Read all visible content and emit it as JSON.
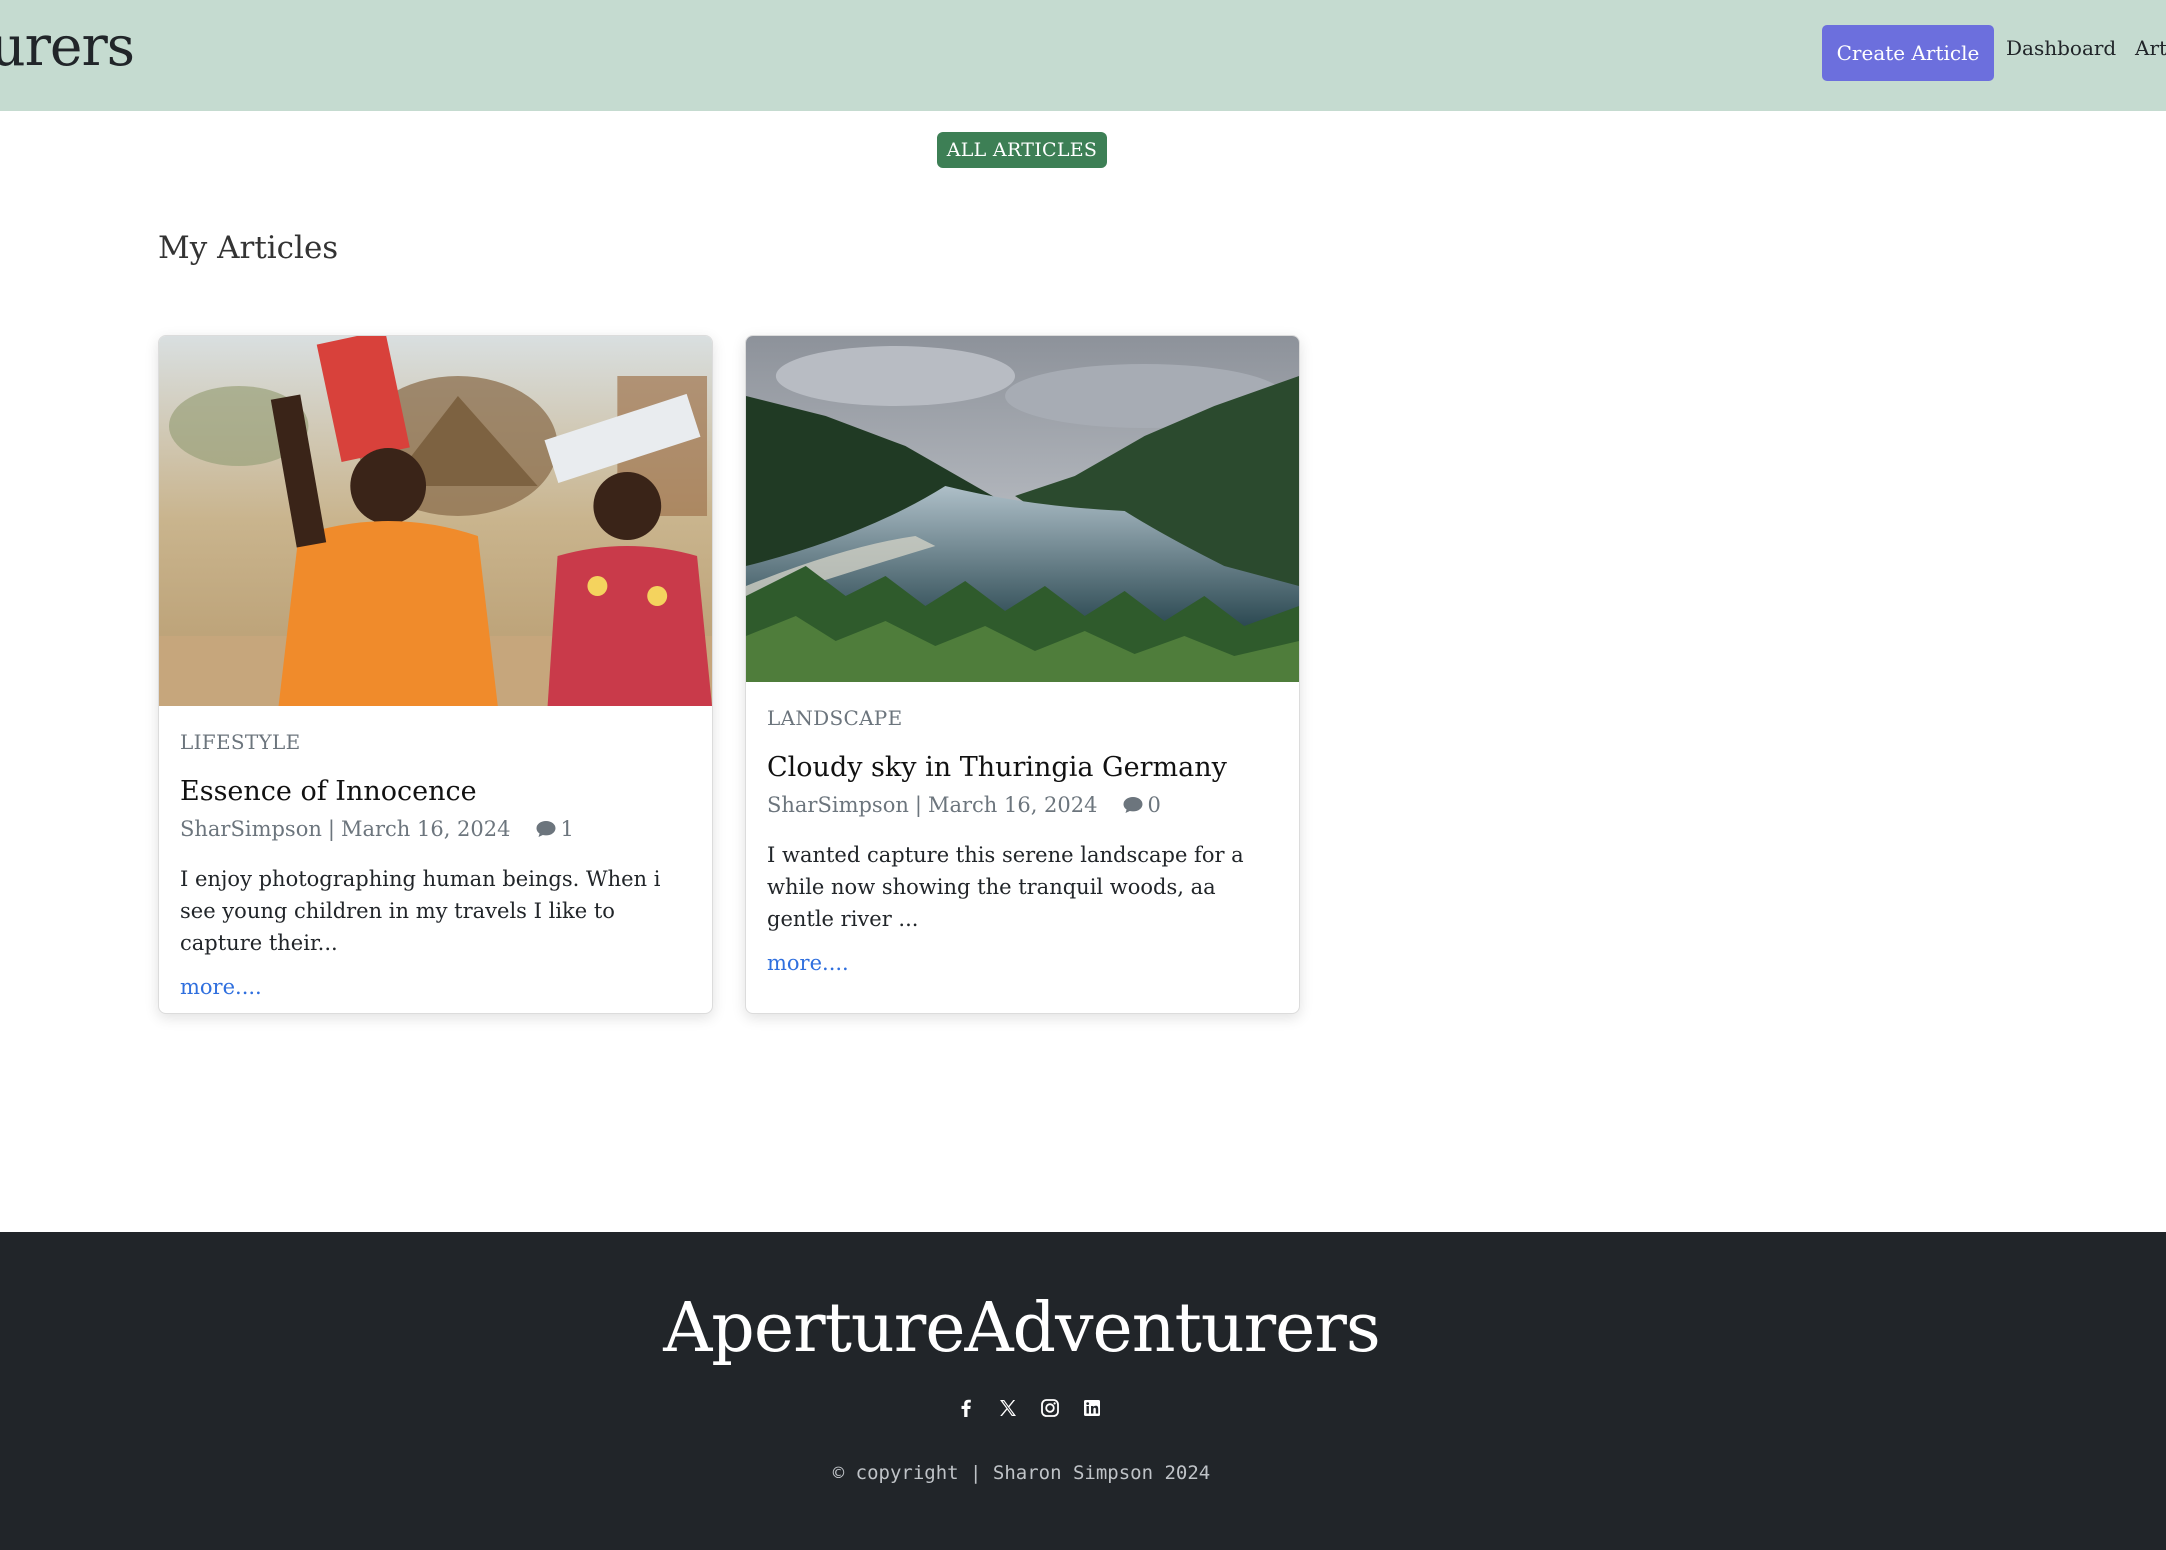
{
  "header": {
    "brand": "ApertureAdventurers",
    "create_label": "Create Article",
    "nav": {
      "dashboard": "Dashboard",
      "articles": "Articles"
    }
  },
  "badge": {
    "label": "ALL ARTICLES"
  },
  "page_title": "My Articles",
  "articles": [
    {
      "category": "LIFESTYLE",
      "title": "Essence of Innocence",
      "author": "SharSimpson",
      "separator": "|",
      "date": "March 16, 2024",
      "comments": "1",
      "excerpt": "I enjoy photographing human beings. When i see young children in my travels I like to capture their...",
      "more": "more...."
    },
    {
      "category": "LANDSCAPE",
      "title": "Cloudy sky in Thuringia Germany",
      "author": "SharSimpson",
      "separator": "|",
      "date": "March 16, 2024",
      "comments": "0",
      "excerpt": "I wanted capture this serene landscape for a while now showing the tranquil woods, aa gentle river ...",
      "more": "more...."
    }
  ],
  "footer": {
    "brand": "ApertureAdventurers",
    "copyright": "copyright | Sharon Simpson 2024",
    "socials": [
      "facebook-icon",
      "x-icon",
      "instagram-icon",
      "linkedin-icon"
    ]
  },
  "colors": {
    "navbar": "#c5dbd0",
    "create_button": "#6c6fdd",
    "badge": "#3d7f55",
    "link": "#2f6fde",
    "footer": "#212529"
  }
}
